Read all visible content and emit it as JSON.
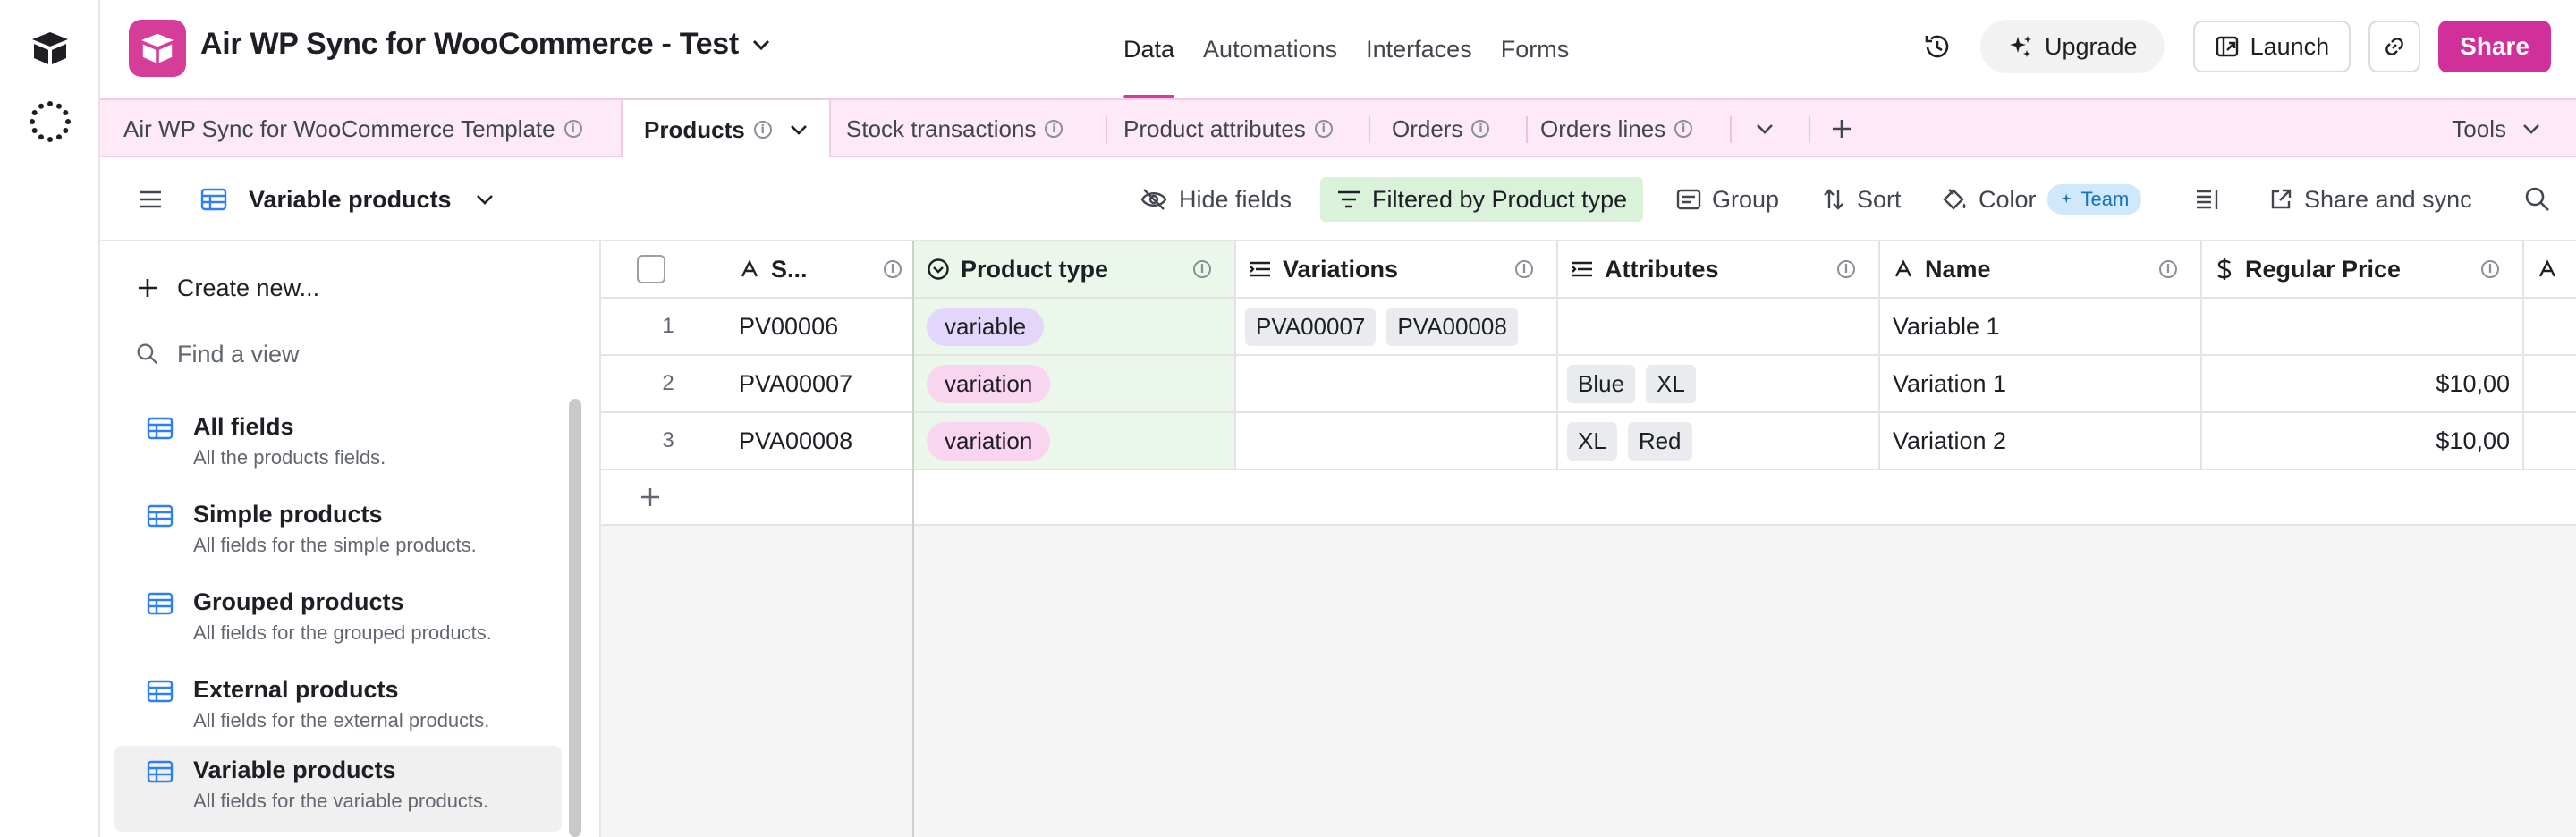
{
  "header": {
    "base_title": "Air WP Sync for WooCommerce - Test",
    "nav": [
      "Data",
      "Automations",
      "Interfaces",
      "Forms"
    ],
    "upgrade_label": "Upgrade",
    "launch_label": "Launch",
    "share_label": "Share",
    "accent_color": "#d1309a"
  },
  "tabs": {
    "items": [
      "Air WP Sync for WooCommerce Template",
      "Products",
      "Stock transactions",
      "Product attributes",
      "Orders",
      "Orders lines"
    ],
    "active": "Products",
    "tools_label": "Tools"
  },
  "toolbar": {
    "view_name": "Variable products",
    "hide_fields": "Hide fields",
    "filter": "Filtered by Product type",
    "group": "Group",
    "sort": "Sort",
    "color": "Color",
    "team_badge": "Team",
    "share_sync": "Share and sync"
  },
  "sidebar": {
    "create_new": "Create new...",
    "find_view": "Find a view",
    "views": [
      {
        "name": "All fields",
        "desc": "All the products fields."
      },
      {
        "name": "Simple products",
        "desc": "All fields for the simple products."
      },
      {
        "name": "Grouped products",
        "desc": "All fields for the grouped products."
      },
      {
        "name": "External products",
        "desc": "All fields for the external products."
      },
      {
        "name": "Variable products",
        "desc": "All fields for the variable products."
      }
    ],
    "selected_view": "Variable products"
  },
  "grid": {
    "columns": [
      "S...",
      "Product type",
      "Variations",
      "Attributes",
      "Name",
      "Regular Price"
    ],
    "rows": [
      {
        "num": "1",
        "sku": "PV00006",
        "type": "variable",
        "variations": [
          "PVA00007",
          "PVA00008"
        ],
        "attributes": [],
        "name": "Variable 1",
        "price": ""
      },
      {
        "num": "2",
        "sku": "PVA00007",
        "type": "variation",
        "variations": [],
        "attributes": [
          "Blue",
          "XL"
        ],
        "name": "Variation 1",
        "price": "$10,00"
      },
      {
        "num": "3",
        "sku": "PVA00008",
        "type": "variation",
        "variations": [],
        "attributes": [
          "XL",
          "Red"
        ],
        "name": "Variation 2",
        "price": "$10,00"
      }
    ]
  }
}
